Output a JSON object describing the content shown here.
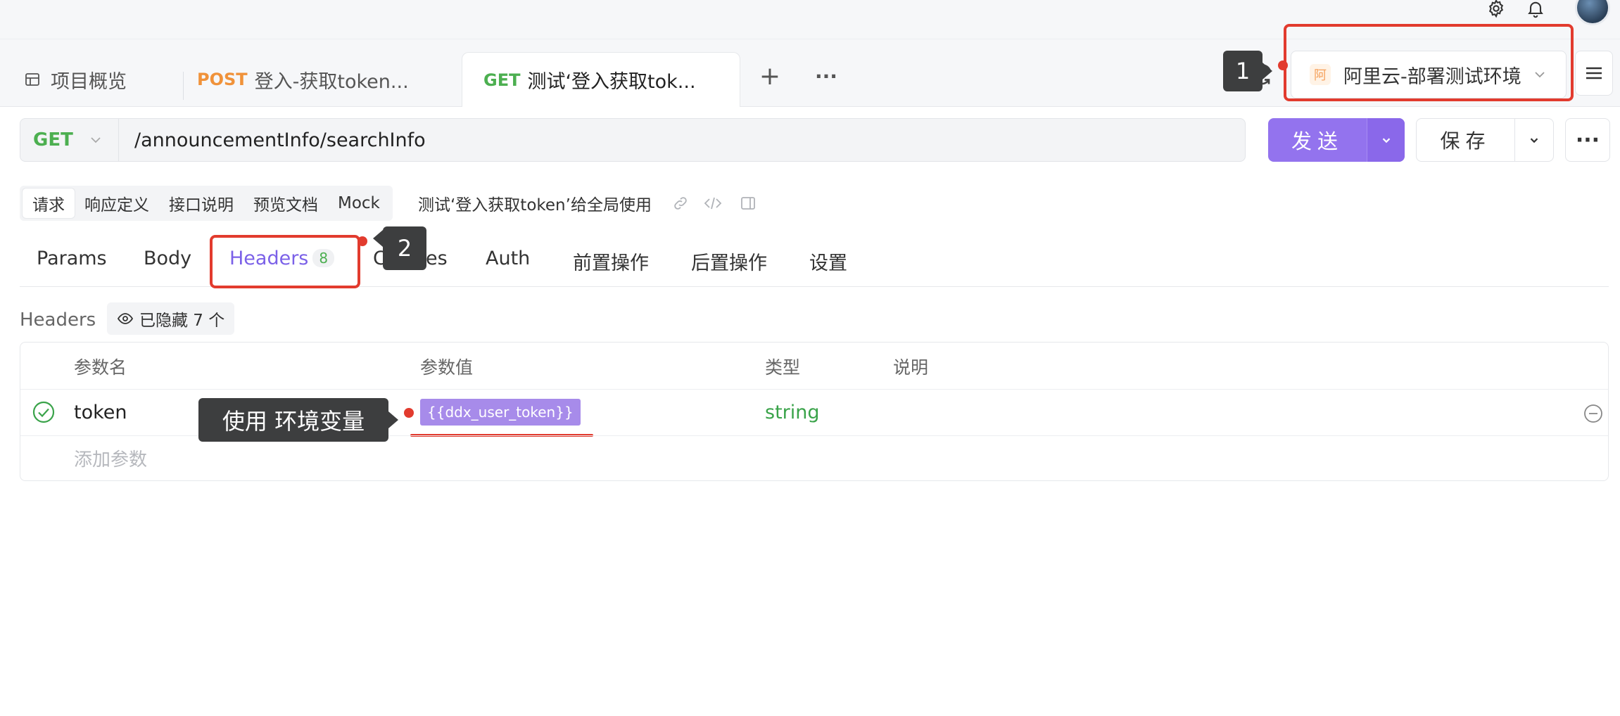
{
  "topbar": {
    "icons": [
      "gear-icon",
      "bell-icon",
      "avatar"
    ]
  },
  "tabs": {
    "overview_label": "项目概览",
    "tab1_method": "POST",
    "tab1_title": "登入-获取token...",
    "tab2_method": "GET",
    "tab2_title": "测试‘登入获取tok...",
    "add_label": "+",
    "more_label": "···"
  },
  "environment": {
    "badge": "阿",
    "name": "阿里云-部署测试环境"
  },
  "request": {
    "method": "GET",
    "url": "/announcementInfo/searchInfo",
    "send_label": "发送",
    "save_label": "保存",
    "more_label": "···"
  },
  "subnav": {
    "items": [
      "请求",
      "响应定义",
      "接口说明",
      "预览文档",
      "Mock"
    ],
    "title": "测试‘登入获取token’给全局使用"
  },
  "param_tabs": {
    "items": [
      "Params",
      "Body",
      "Headers",
      "Cookies",
      "Auth",
      "前置操作",
      "后置操作",
      "设置"
    ],
    "headers_count": "8"
  },
  "headers_section": {
    "label": "Headers",
    "hidden_label": "已隐藏 7 个"
  },
  "table": {
    "columns": [
      "参数名",
      "参数值",
      "类型",
      "说明"
    ],
    "rows": [
      {
        "name": "token",
        "value": "{{ddx_user_token}}",
        "type": "string",
        "description": ""
      }
    ],
    "add_placeholder": "添加参数"
  },
  "annotations": {
    "callout1": "1",
    "callout2": "2",
    "callout3": "使用 环境变量",
    "color": "#e23b2e"
  },
  "colors": {
    "accent": "#9373ee",
    "get": "#4caf50",
    "post": "#f0923a",
    "annotation": "#e23b2e"
  }
}
